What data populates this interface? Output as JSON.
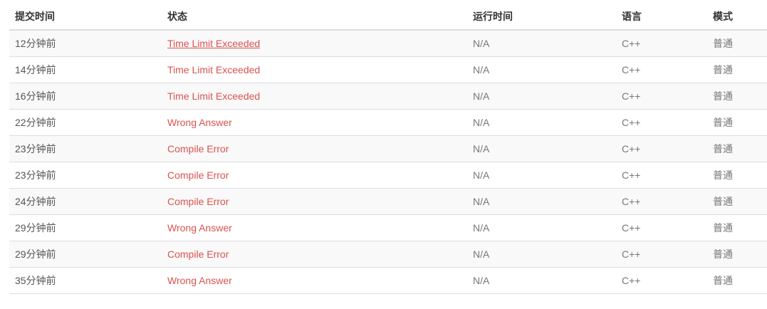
{
  "headers": {
    "time": "提交时间",
    "status": "状态",
    "runtime": "运行时间",
    "language": "语言",
    "mode": "模式"
  },
  "colors": {
    "status_red": "#d9534f",
    "border": "#dddddd",
    "stripe": "#f9f9f9"
  },
  "rows": [
    {
      "time": "12分钟前",
      "status": "Time Limit Exceeded",
      "runtime": "N/A",
      "language": "C++",
      "mode": "普通",
      "hovered": true
    },
    {
      "time": "14分钟前",
      "status": "Time Limit Exceeded",
      "runtime": "N/A",
      "language": "C++",
      "mode": "普通"
    },
    {
      "time": "16分钟前",
      "status": "Time Limit Exceeded",
      "runtime": "N/A",
      "language": "C++",
      "mode": "普通"
    },
    {
      "time": "22分钟前",
      "status": "Wrong Answer",
      "runtime": "N/A",
      "language": "C++",
      "mode": "普通"
    },
    {
      "time": "23分钟前",
      "status": "Compile Error",
      "runtime": "N/A",
      "language": "C++",
      "mode": "普通"
    },
    {
      "time": "23分钟前",
      "status": "Compile Error",
      "runtime": "N/A",
      "language": "C++",
      "mode": "普通"
    },
    {
      "time": "24分钟前",
      "status": "Compile Error",
      "runtime": "N/A",
      "language": "C++",
      "mode": "普通"
    },
    {
      "time": "29分钟前",
      "status": "Wrong Answer",
      "runtime": "N/A",
      "language": "C++",
      "mode": "普通"
    },
    {
      "time": "29分钟前",
      "status": "Compile Error",
      "runtime": "N/A",
      "language": "C++",
      "mode": "普通"
    },
    {
      "time": "35分钟前",
      "status": "Wrong Answer",
      "runtime": "N/A",
      "language": "C++",
      "mode": "普通"
    }
  ]
}
